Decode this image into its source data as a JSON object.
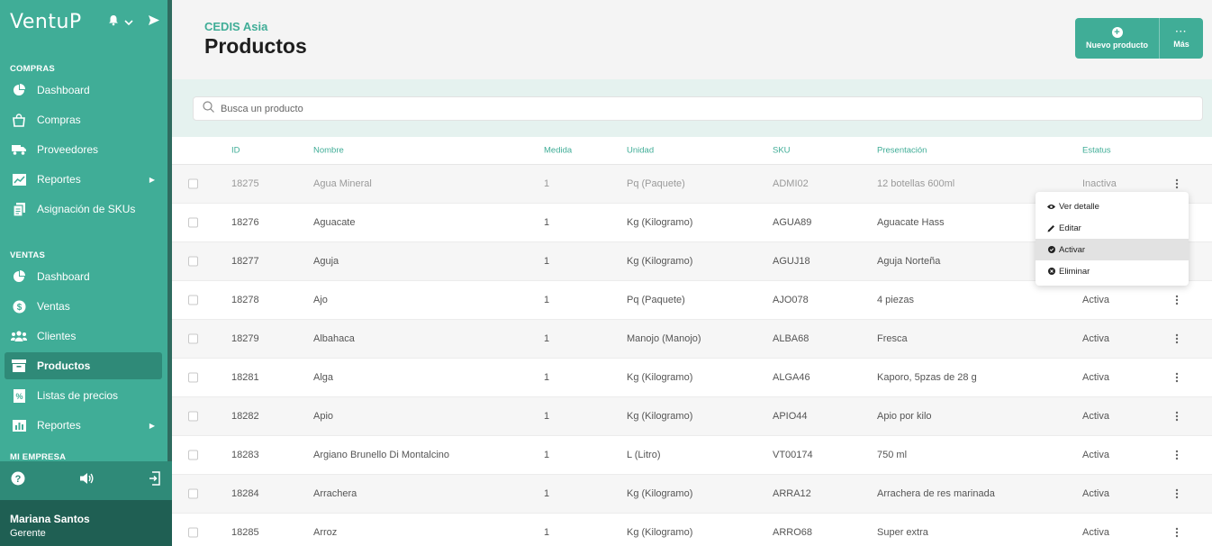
{
  "app": {
    "logo": "VentuP"
  },
  "sidebar": {
    "sections": {
      "compras": "COMPRAS",
      "ventas": "VENTAS",
      "mi_empresa": "MI EMPRESA"
    },
    "compras_items": [
      {
        "label": "Dashboard",
        "icon": "pie-chart-icon"
      },
      {
        "label": "Compras",
        "icon": "shopping-bag-icon"
      },
      {
        "label": "Proveedores",
        "icon": "truck-icon"
      },
      {
        "label": "Reportes",
        "icon": "chart-icon",
        "has_submenu": true
      },
      {
        "label": "Asignación de SKUs",
        "icon": "copy-icon"
      }
    ],
    "ventas_items": [
      {
        "label": "Dashboard",
        "icon": "pie-chart-icon"
      },
      {
        "label": "Ventas",
        "icon": "dollar-icon"
      },
      {
        "label": "Clientes",
        "icon": "users-icon"
      },
      {
        "label": "Productos",
        "icon": "archive-icon",
        "active": true
      },
      {
        "label": "Listas de precios",
        "icon": "price-list-icon"
      },
      {
        "label": "Reportes",
        "icon": "chart-icon",
        "has_submenu": true
      }
    ],
    "user": {
      "name": "Mariana Santos",
      "role": "Gerente"
    }
  },
  "header": {
    "subtitle": "CEDIS Asia",
    "title": "Productos",
    "new_button": "Nuevo producto",
    "more_button": "Más"
  },
  "search": {
    "placeholder": "Busca un producto"
  },
  "table": {
    "columns": [
      "ID",
      "Nombre",
      "Medida",
      "Unidad",
      "SKU",
      "Presentación",
      "Estatus"
    ],
    "rows": [
      {
        "id": "18275",
        "nombre": "Agua Mineral",
        "medida": "1",
        "unidad": "Pq (Paquete)",
        "sku": "ADMI02",
        "presentacion": "12 botellas 600ml",
        "estatus": "Inactiva"
      },
      {
        "id": "18276",
        "nombre": "Aguacate",
        "medida": "1",
        "unidad": "Kg (Kilogramo)",
        "sku": "AGUA89",
        "presentacion": "Aguacate Hass",
        "estatus": ""
      },
      {
        "id": "18277",
        "nombre": "Aguja",
        "medida": "1",
        "unidad": "Kg (Kilogramo)",
        "sku": "AGUJ18",
        "presentacion": "Aguja Norteña",
        "estatus": ""
      },
      {
        "id": "18278",
        "nombre": "Ajo",
        "medida": "1",
        "unidad": "Pq (Paquete)",
        "sku": "AJO078",
        "presentacion": "4 piezas",
        "estatus": "Activa"
      },
      {
        "id": "18279",
        "nombre": "Albahaca",
        "medida": "1",
        "unidad": "Manojo (Manojo)",
        "sku": "ALBA68",
        "presentacion": "Fresca",
        "estatus": "Activa"
      },
      {
        "id": "18281",
        "nombre": "Alga",
        "medida": "1",
        "unidad": "Kg (Kilogramo)",
        "sku": "ALGA46",
        "presentacion": "Kaporo, 5pzas de 28 g",
        "estatus": "Activa"
      },
      {
        "id": "18282",
        "nombre": "Apio",
        "medida": "1",
        "unidad": "Kg (Kilogramo)",
        "sku": "APIO44",
        "presentacion": "Apio por kilo",
        "estatus": "Activa"
      },
      {
        "id": "18283",
        "nombre": "Argiano Brunello Di Montalcino",
        "medida": "1",
        "unidad": "L (Litro)",
        "sku": "VT00174",
        "presentacion": "750 ml",
        "estatus": "Activa"
      },
      {
        "id": "18284",
        "nombre": "Arrachera",
        "medida": "1",
        "unidad": "Kg (Kilogramo)",
        "sku": "ARRA12",
        "presentacion": "Arrachera de res marinada",
        "estatus": "Activa"
      },
      {
        "id": "18285",
        "nombre": "Arroz",
        "medida": "1",
        "unidad": "Kg (Kilogramo)",
        "sku": "ARRO68",
        "presentacion": "Super extra",
        "estatus": "Activa"
      }
    ]
  },
  "row_menu": {
    "items": [
      {
        "label": "Ver detalle",
        "icon": "eye-icon"
      },
      {
        "label": "Editar",
        "icon": "pencil-icon"
      },
      {
        "label": "Activar",
        "icon": "check-circle-icon",
        "hovered": true
      },
      {
        "label": "Eliminar",
        "icon": "delete-circle-icon"
      }
    ]
  },
  "colors": {
    "brand": "#40ad97",
    "sidebar_active": "#2f8a78",
    "user_panel": "#1f5f53"
  }
}
